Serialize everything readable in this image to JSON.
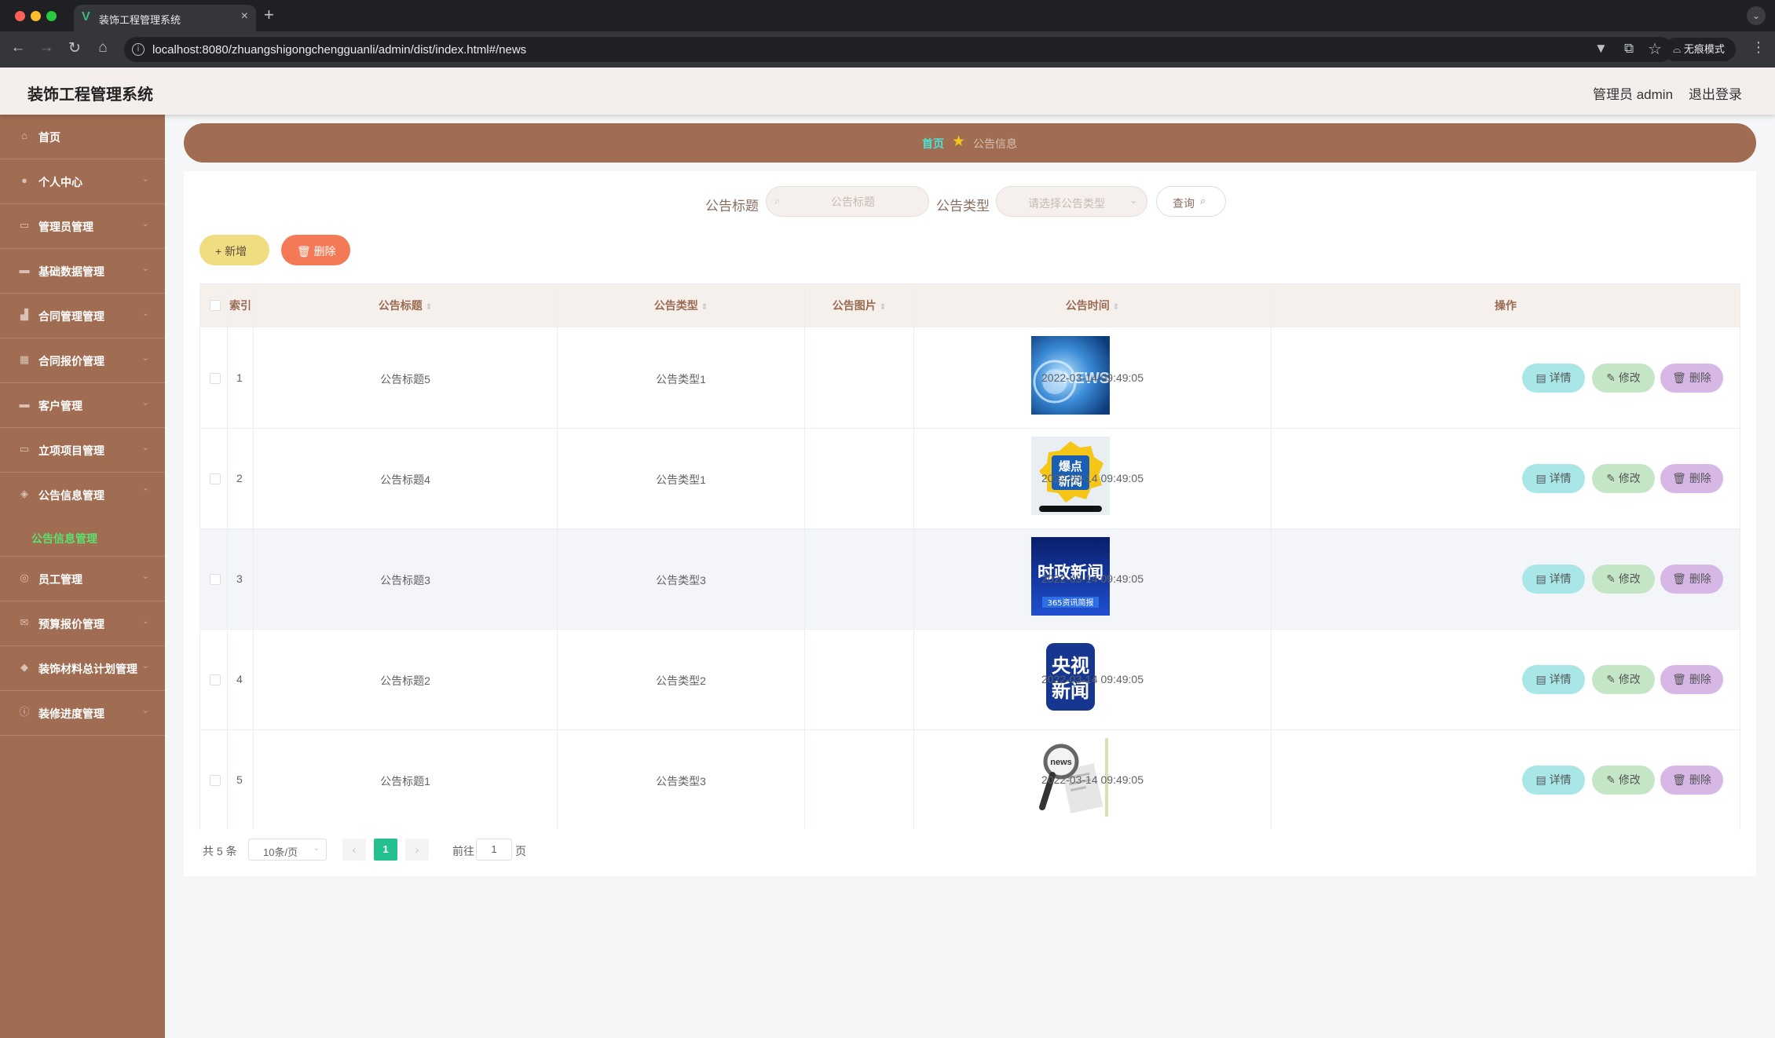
{
  "browser": {
    "tab_title": "装饰工程管理系统",
    "url": "localhost:8080/zhuangshigongchengguanli/admin/dist/index.html#/news",
    "incognito_label": "无痕模式"
  },
  "header": {
    "app_title": "装饰工程管理系统",
    "user": "管理员 admin",
    "logout": "退出登录"
  },
  "sidebar": {
    "items": [
      {
        "label": "首页",
        "icon": "home-icon"
      },
      {
        "label": "个人中心",
        "icon": "user-icon"
      },
      {
        "label": "管理员管理",
        "icon": "chat-icon"
      },
      {
        "label": "基础数据管理",
        "icon": "bank-icon"
      },
      {
        "label": "合同管理管理",
        "icon": "chart-icon"
      },
      {
        "label": "合同报价管理",
        "icon": "grid-icon"
      },
      {
        "label": "客户管理",
        "icon": "message-icon"
      },
      {
        "label": "立项项目管理",
        "icon": "monitor-icon"
      },
      {
        "label": "公告信息管理",
        "icon": "location-icon"
      },
      {
        "label": "员工管理",
        "icon": "globe-icon"
      },
      {
        "label": "预算报价管理",
        "icon": "mail-icon"
      },
      {
        "label": "装饰材料总计划管理",
        "icon": "shield-icon"
      },
      {
        "label": "装修进度管理",
        "icon": "info-icon"
      }
    ],
    "subitem": "公告信息管理"
  },
  "breadcrumb": {
    "home": "首页",
    "current": "公告信息"
  },
  "search": {
    "title_label": "公告标题",
    "title_placeholder": "公告标题",
    "type_label": "公告类型",
    "type_placeholder": "请选择公告类型",
    "query_button": "查询"
  },
  "toolbar": {
    "add_label": "新增",
    "delete_label": "删除"
  },
  "table": {
    "headers": [
      "索引",
      "公告标题",
      "公告类型",
      "公告图片",
      "公告时间",
      "操作"
    ],
    "rows": [
      {
        "index": "1",
        "title": "公告标题5",
        "type": "公告类型1",
        "image": "news-image-blue",
        "time": "2022-03-14 09:49:05"
      },
      {
        "index": "2",
        "title": "公告标题4",
        "type": "公告类型1",
        "image": "news-image-hot",
        "time": "2022-03-14 09:49:05"
      },
      {
        "index": "3",
        "title": "公告标题3",
        "type": "公告类型3",
        "image": "news-image-politics",
        "time": "2022-03-14 09:49:05"
      },
      {
        "index": "4",
        "title": "公告标题2",
        "type": "公告类型2",
        "image": "news-image-cctv",
        "time": "2022-03-14 09:49:05"
      },
      {
        "index": "5",
        "title": "公告标题1",
        "type": "公告类型3",
        "image": "news-image-magnifier",
        "time": "2022-03-14 09:49:05"
      }
    ],
    "actions": {
      "detail": "详情",
      "edit": "修改",
      "delete": "删除"
    }
  },
  "images": {
    "hot_line1": "爆点",
    "hot_line2": "新闻",
    "politics_line1": "时政新闻",
    "politics_line2": "365资讯简报",
    "cctv_line1": "央视",
    "cctv_line2": "新闻",
    "news_word": "NEWS",
    "news_small": "news"
  },
  "pagination": {
    "total": "共 5 条",
    "page_size": "10条/页",
    "current_page": "1",
    "goto_label": "前往",
    "goto_value": "1",
    "page_suffix": "页"
  },
  "colors": {
    "sidebar": "#a06c52",
    "accent_green": "#5ce06e",
    "active_page": "#25c08f"
  }
}
